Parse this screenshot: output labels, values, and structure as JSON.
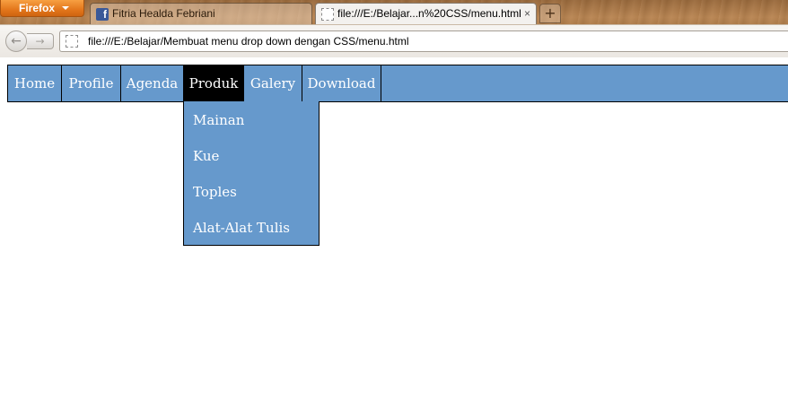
{
  "browser": {
    "app_button_label": "Firefox",
    "tabs": [
      {
        "label": "Fitria Healda Febriani",
        "favicon": "facebook-icon",
        "active": false
      },
      {
        "label": "file:///E:/Belajar...n%20CSS/menu.html",
        "favicon": "blank-page-icon",
        "active": true,
        "close": "×"
      }
    ],
    "new_tab_label": "+",
    "back_glyph": "←",
    "forward_glyph": "→",
    "url": "file:///E:/Belajar/Membuat menu drop down dengan CSS/menu.html"
  },
  "menu": {
    "items": [
      {
        "label": "Home"
      },
      {
        "label": "Profile"
      },
      {
        "label": "Agenda"
      },
      {
        "label": "Produk",
        "active": true
      },
      {
        "label": "Galery"
      },
      {
        "label": "Download"
      }
    ],
    "dropdown": [
      {
        "label": "Mainan"
      },
      {
        "label": "Kue"
      },
      {
        "label": "Toples"
      },
      {
        "label": "Alat-Alat Tulis"
      }
    ]
  },
  "colors": {
    "menu_bg": "#6699cc",
    "menu_active_bg": "#000000",
    "menu_text": "#ffffff",
    "border": "#000000",
    "firefox_button": "#e3761b"
  }
}
